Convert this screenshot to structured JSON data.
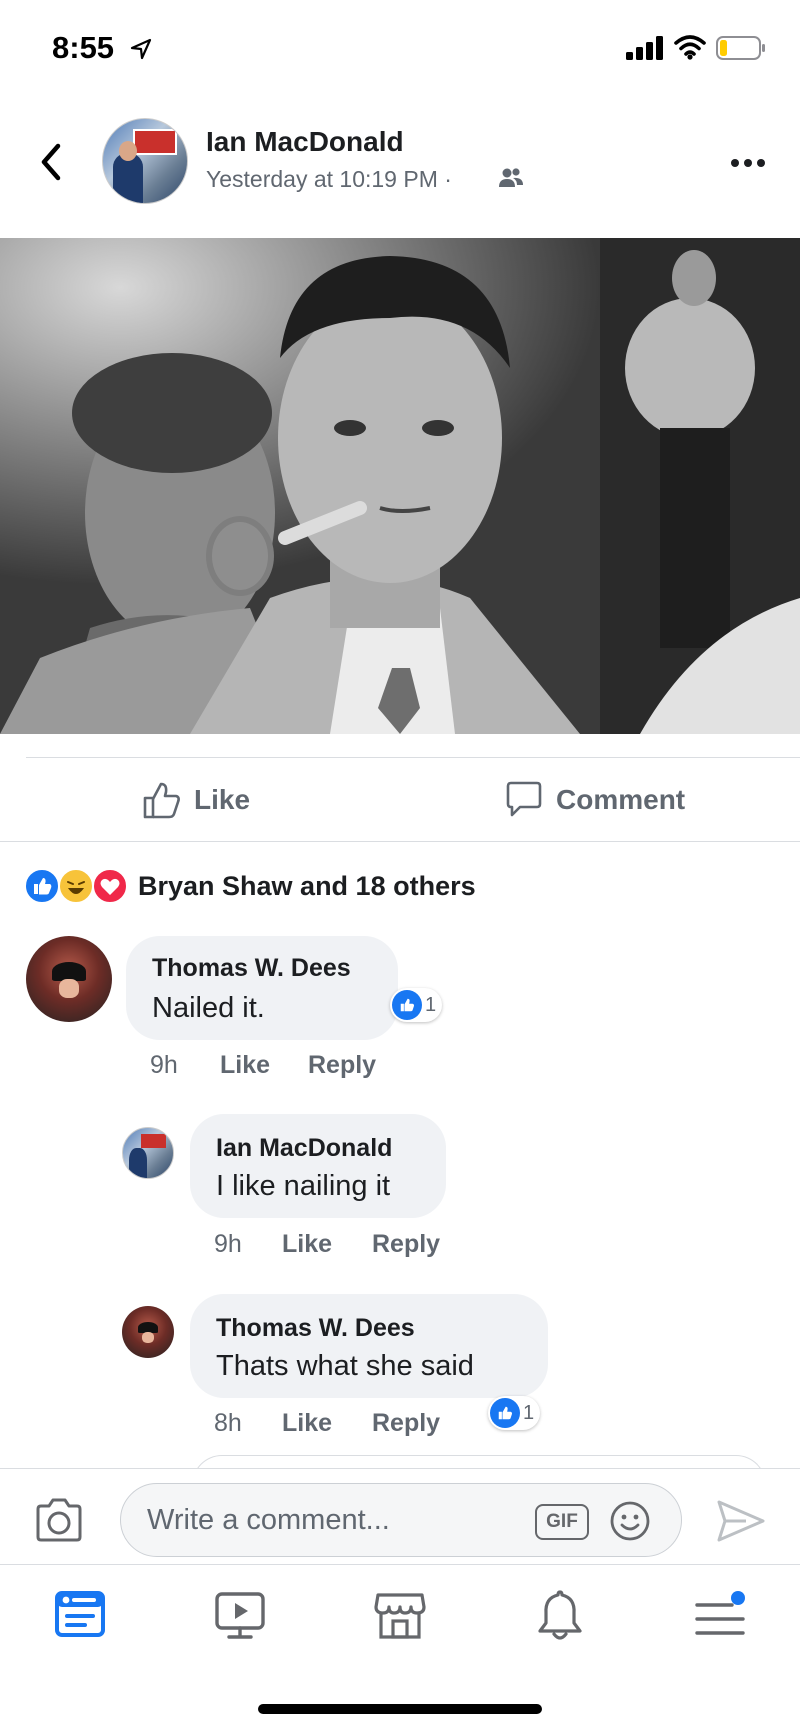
{
  "status_bar": {
    "time": "8:55"
  },
  "post": {
    "author": "Ian MacDonald",
    "timestamp": "Yesterday at 10:19 PM ·",
    "photo_icon": "black-and-white-portrait-man-with-corncob-pipe"
  },
  "actions": {
    "like_label": "Like",
    "comment_label": "Comment"
  },
  "reactions": {
    "summary": "Bryan Shaw and 18 others",
    "icons": [
      "like-reaction-icon",
      "haha-reaction-icon",
      "love-reaction-icon"
    ]
  },
  "comments": [
    {
      "name": "Thomas W. Dees",
      "text": "Nailed it.",
      "time": "9h",
      "like": "Like",
      "reply": "Reply",
      "likes": "1"
    },
    {
      "name": "Ian MacDonald",
      "text": "I like nailing it",
      "time": "9h",
      "like": "Like",
      "reply": "Reply"
    },
    {
      "name": "Thomas W. Dees",
      "text": "Thats what she said",
      "time": "8h",
      "like": "Like",
      "reply": "Reply",
      "likes": "1"
    }
  ],
  "composer": {
    "placeholder": "Write a comment...",
    "gif_label": "GIF"
  },
  "tabs": [
    "news-feed",
    "watch",
    "marketplace",
    "notifications",
    "menu"
  ],
  "colors": {
    "accent": "#1877f2",
    "secondary_text": "#606770",
    "bubble": "#f0f2f5"
  }
}
